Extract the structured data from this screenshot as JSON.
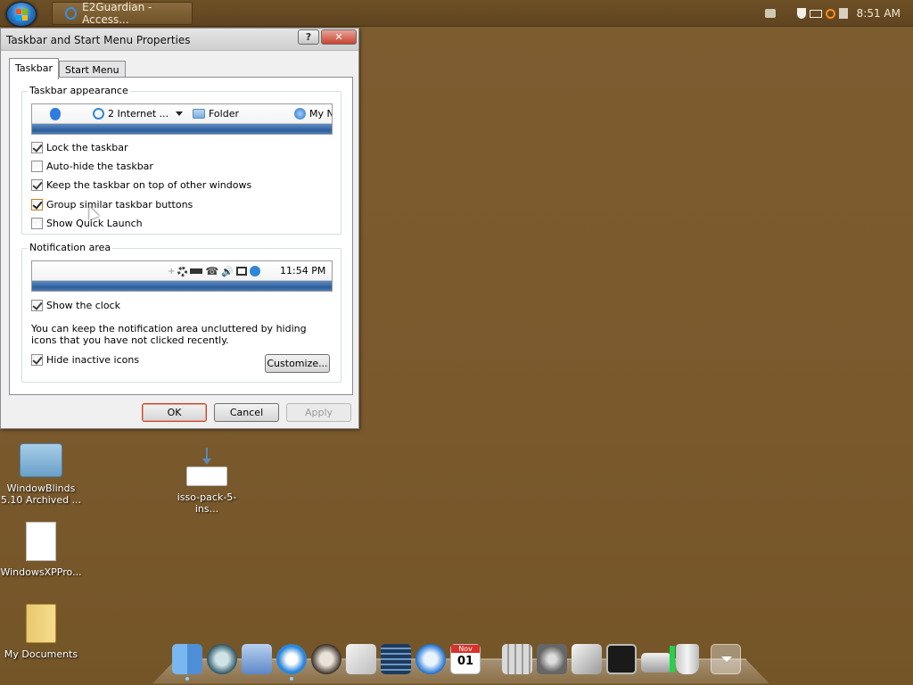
{
  "taskbar": {
    "task_button_label": "E2Guardian - Access...",
    "clock": "8:51 AM"
  },
  "dialog": {
    "title": "Taskbar and Start Menu Properties",
    "help_label": "?",
    "close_label": "✕",
    "tabs": [
      {
        "label": "Taskbar",
        "active": true
      },
      {
        "label": "Start Menu",
        "active": false
      }
    ],
    "appearance": {
      "group_title": "Taskbar appearance",
      "preview": {
        "ie_group_label": "2 Internet ...",
        "folder_label": "Folder",
        "mypc_label": "My N"
      },
      "options": [
        {
          "label": "Lock the taskbar",
          "checked": true
        },
        {
          "label": "Auto-hide the taskbar",
          "checked": false
        },
        {
          "label": "Keep the taskbar on top of other windows",
          "checked": true
        },
        {
          "label": "Group similar taskbar buttons",
          "checked": true
        },
        {
          "label": "Show Quick Launch",
          "checked": false
        }
      ]
    },
    "notification": {
      "group_title": "Notification area",
      "preview_clock": "11:54 PM",
      "show_clock_label": "Show the clock",
      "show_clock_checked": true,
      "info_text": "You can keep the notification area uncluttered by hiding icons that you have not clicked recently.",
      "hide_inactive_label": "Hide inactive icons",
      "hide_inactive_checked": true,
      "customize_label": "Customize..."
    },
    "buttons": {
      "ok": "OK",
      "cancel": "Cancel",
      "apply": "Apply"
    }
  },
  "desktop_icons": [
    {
      "label": "WindowBlinds 5.10 Archived ...",
      "kind": "folder-blue"
    },
    {
      "label": "isso-pack-5-ins...",
      "kind": "download"
    },
    {
      "label": "WindowsXPPro...",
      "kind": "document"
    },
    {
      "label": "My Documents",
      "kind": "folder-yellow"
    }
  ],
  "dock_items": [
    "finder-icon",
    "time-machine-icon",
    "preview-icon",
    "internet-explorer-icon",
    "raccoon-icon",
    "notepad-icon",
    "film-icon",
    "quicktime-icon",
    "calendar-icon",
    "calculator-icon",
    "system-preferences-icon",
    "script-editor-icon",
    "console-icon",
    "drive-icon",
    "trash-icon",
    "stack-icon"
  ],
  "dock_calendar": {
    "month": "Nov",
    "day": "01"
  },
  "colors": {
    "desktop": "#7a5b2f",
    "taskbar": "#5f4420",
    "dialog_bg": "#f0f0f0",
    "preview_stripe": "#2d5e9c",
    "close_red": "#c84430"
  }
}
